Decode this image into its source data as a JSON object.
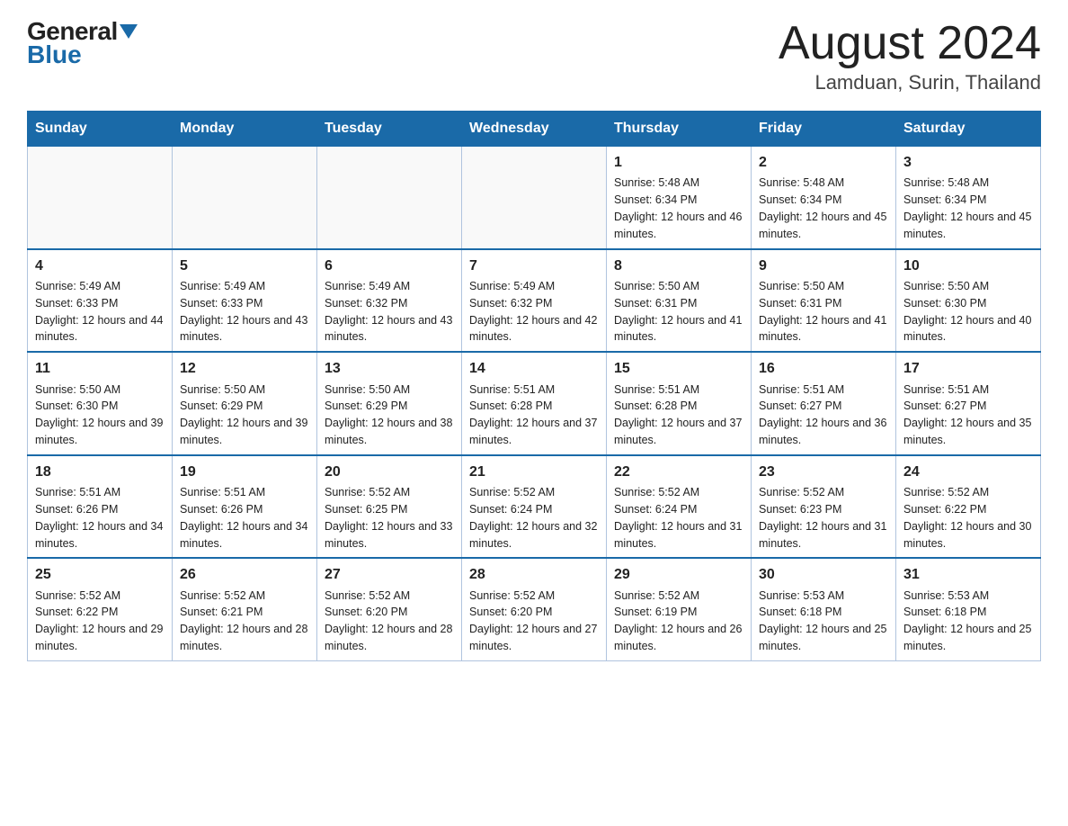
{
  "header": {
    "logo_general": "General",
    "logo_blue": "Blue",
    "month_year": "August 2024",
    "location": "Lamduan, Surin, Thailand"
  },
  "days_of_week": [
    "Sunday",
    "Monday",
    "Tuesday",
    "Wednesday",
    "Thursday",
    "Friday",
    "Saturday"
  ],
  "weeks": [
    [
      {
        "day": "",
        "info": ""
      },
      {
        "day": "",
        "info": ""
      },
      {
        "day": "",
        "info": ""
      },
      {
        "day": "",
        "info": ""
      },
      {
        "day": "1",
        "info": "Sunrise: 5:48 AM\nSunset: 6:34 PM\nDaylight: 12 hours and 46 minutes."
      },
      {
        "day": "2",
        "info": "Sunrise: 5:48 AM\nSunset: 6:34 PM\nDaylight: 12 hours and 45 minutes."
      },
      {
        "day": "3",
        "info": "Sunrise: 5:48 AM\nSunset: 6:34 PM\nDaylight: 12 hours and 45 minutes."
      }
    ],
    [
      {
        "day": "4",
        "info": "Sunrise: 5:49 AM\nSunset: 6:33 PM\nDaylight: 12 hours and 44 minutes."
      },
      {
        "day": "5",
        "info": "Sunrise: 5:49 AM\nSunset: 6:33 PM\nDaylight: 12 hours and 43 minutes."
      },
      {
        "day": "6",
        "info": "Sunrise: 5:49 AM\nSunset: 6:32 PM\nDaylight: 12 hours and 43 minutes."
      },
      {
        "day": "7",
        "info": "Sunrise: 5:49 AM\nSunset: 6:32 PM\nDaylight: 12 hours and 42 minutes."
      },
      {
        "day": "8",
        "info": "Sunrise: 5:50 AM\nSunset: 6:31 PM\nDaylight: 12 hours and 41 minutes."
      },
      {
        "day": "9",
        "info": "Sunrise: 5:50 AM\nSunset: 6:31 PM\nDaylight: 12 hours and 41 minutes."
      },
      {
        "day": "10",
        "info": "Sunrise: 5:50 AM\nSunset: 6:30 PM\nDaylight: 12 hours and 40 minutes."
      }
    ],
    [
      {
        "day": "11",
        "info": "Sunrise: 5:50 AM\nSunset: 6:30 PM\nDaylight: 12 hours and 39 minutes."
      },
      {
        "day": "12",
        "info": "Sunrise: 5:50 AM\nSunset: 6:29 PM\nDaylight: 12 hours and 39 minutes."
      },
      {
        "day": "13",
        "info": "Sunrise: 5:50 AM\nSunset: 6:29 PM\nDaylight: 12 hours and 38 minutes."
      },
      {
        "day": "14",
        "info": "Sunrise: 5:51 AM\nSunset: 6:28 PM\nDaylight: 12 hours and 37 minutes."
      },
      {
        "day": "15",
        "info": "Sunrise: 5:51 AM\nSunset: 6:28 PM\nDaylight: 12 hours and 37 minutes."
      },
      {
        "day": "16",
        "info": "Sunrise: 5:51 AM\nSunset: 6:27 PM\nDaylight: 12 hours and 36 minutes."
      },
      {
        "day": "17",
        "info": "Sunrise: 5:51 AM\nSunset: 6:27 PM\nDaylight: 12 hours and 35 minutes."
      }
    ],
    [
      {
        "day": "18",
        "info": "Sunrise: 5:51 AM\nSunset: 6:26 PM\nDaylight: 12 hours and 34 minutes."
      },
      {
        "day": "19",
        "info": "Sunrise: 5:51 AM\nSunset: 6:26 PM\nDaylight: 12 hours and 34 minutes."
      },
      {
        "day": "20",
        "info": "Sunrise: 5:52 AM\nSunset: 6:25 PM\nDaylight: 12 hours and 33 minutes."
      },
      {
        "day": "21",
        "info": "Sunrise: 5:52 AM\nSunset: 6:24 PM\nDaylight: 12 hours and 32 minutes."
      },
      {
        "day": "22",
        "info": "Sunrise: 5:52 AM\nSunset: 6:24 PM\nDaylight: 12 hours and 31 minutes."
      },
      {
        "day": "23",
        "info": "Sunrise: 5:52 AM\nSunset: 6:23 PM\nDaylight: 12 hours and 31 minutes."
      },
      {
        "day": "24",
        "info": "Sunrise: 5:52 AM\nSunset: 6:22 PM\nDaylight: 12 hours and 30 minutes."
      }
    ],
    [
      {
        "day": "25",
        "info": "Sunrise: 5:52 AM\nSunset: 6:22 PM\nDaylight: 12 hours and 29 minutes."
      },
      {
        "day": "26",
        "info": "Sunrise: 5:52 AM\nSunset: 6:21 PM\nDaylight: 12 hours and 28 minutes."
      },
      {
        "day": "27",
        "info": "Sunrise: 5:52 AM\nSunset: 6:20 PM\nDaylight: 12 hours and 28 minutes."
      },
      {
        "day": "28",
        "info": "Sunrise: 5:52 AM\nSunset: 6:20 PM\nDaylight: 12 hours and 27 minutes."
      },
      {
        "day": "29",
        "info": "Sunrise: 5:52 AM\nSunset: 6:19 PM\nDaylight: 12 hours and 26 minutes."
      },
      {
        "day": "30",
        "info": "Sunrise: 5:53 AM\nSunset: 6:18 PM\nDaylight: 12 hours and 25 minutes."
      },
      {
        "day": "31",
        "info": "Sunrise: 5:53 AM\nSunset: 6:18 PM\nDaylight: 12 hours and 25 minutes."
      }
    ]
  ]
}
